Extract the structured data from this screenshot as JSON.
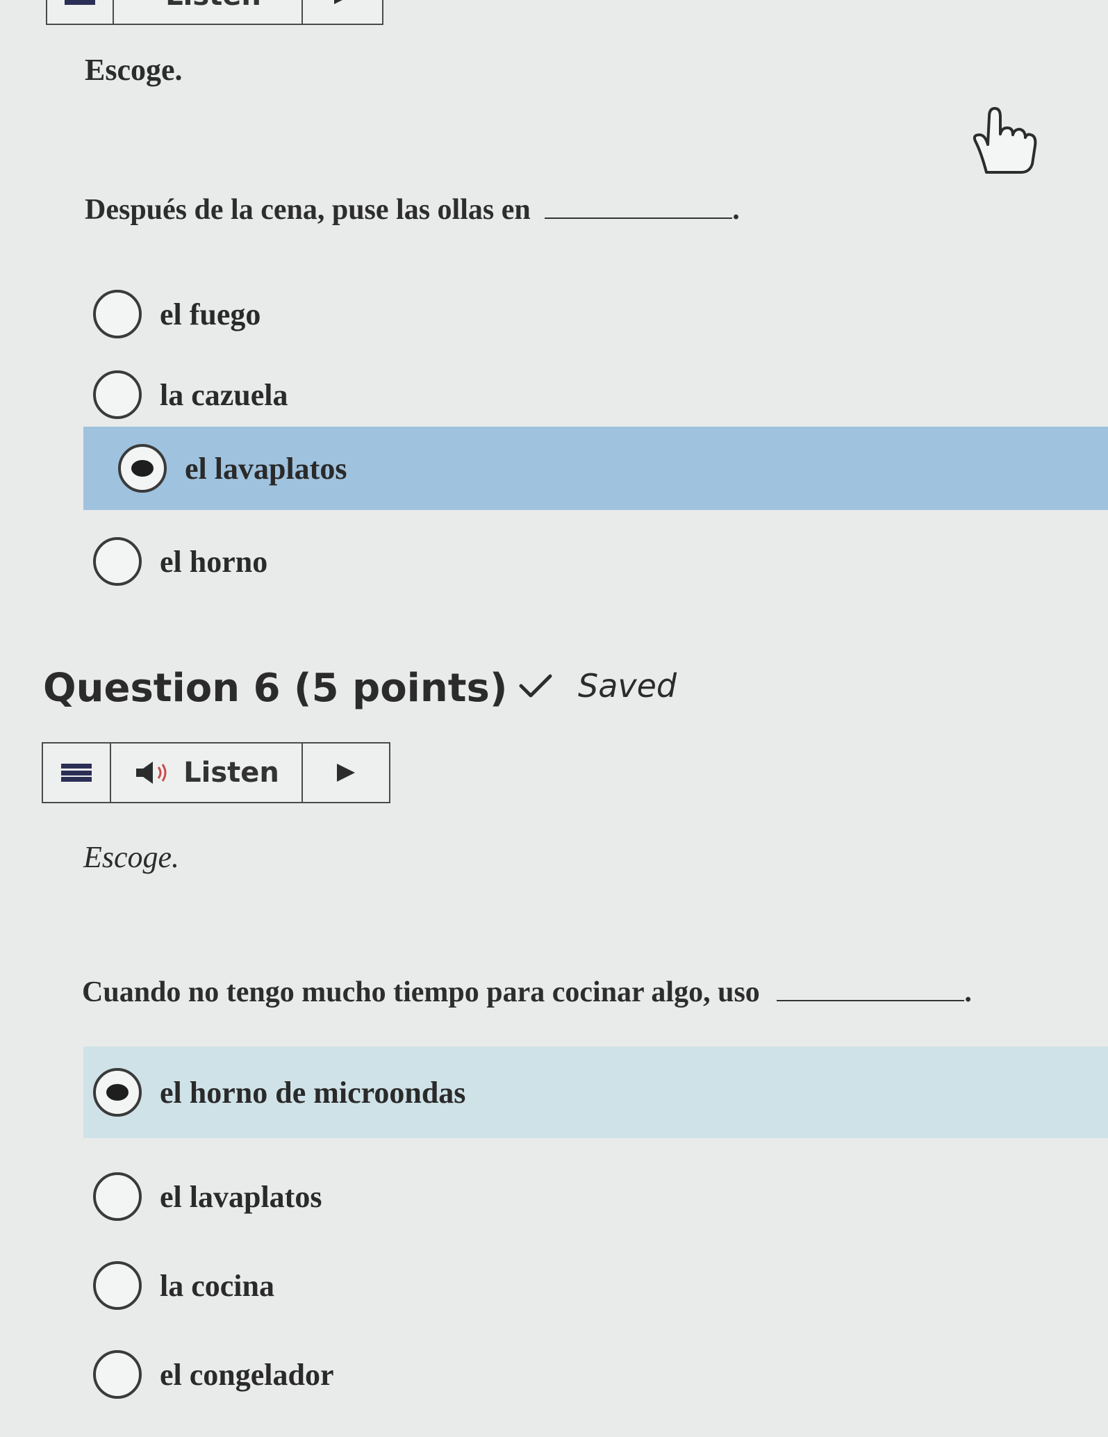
{
  "toolbar_top": {
    "listen_label": "Listen"
  },
  "question5": {
    "instruction": "Escoge.",
    "prompt": "Después de la cena, puse las ollas en",
    "prompt_end": ".",
    "options": [
      {
        "label": "el fuego",
        "selected": false
      },
      {
        "label": "la cazuela",
        "selected": false
      },
      {
        "label": "el lavaplatos",
        "selected": true
      },
      {
        "label": "el horno",
        "selected": false
      }
    ]
  },
  "question6": {
    "heading": "Question 6 (5 points)",
    "status": "Saved",
    "listen_label": "Listen",
    "instruction": "Escoge.",
    "prompt": "Cuando no tengo mucho tiempo para cocinar algo, uso",
    "prompt_end": ".",
    "options": [
      {
        "label": "el horno de microondas",
        "selected": true
      },
      {
        "label": "el lavaplatos",
        "selected": false
      },
      {
        "label": "la cocina",
        "selected": false
      },
      {
        "label": "el congelador",
        "selected": false
      }
    ]
  },
  "colors": {
    "selected_bg": "#9fc2de",
    "selected_bg_soft": "#cfe2e8",
    "menu_icon": "#2b2f55"
  },
  "icons": [
    "menu-icon",
    "speaker-icon",
    "play-icon",
    "checkmark-icon",
    "hand-pointer-icon"
  ]
}
